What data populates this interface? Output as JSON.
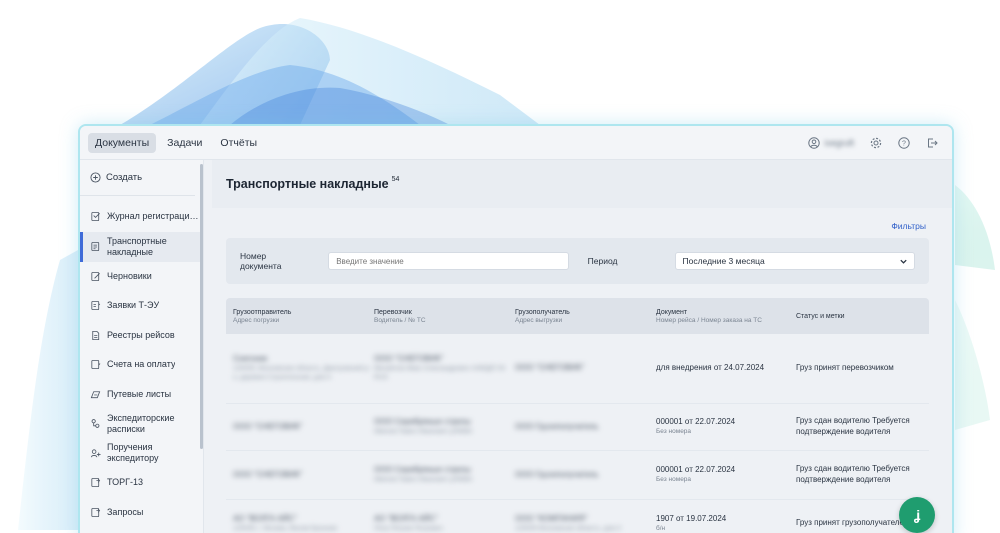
{
  "topbar": {
    "tabs": [
      {
        "label": "Документы",
        "active": true
      },
      {
        "label": "Задачи",
        "active": false
      },
      {
        "label": "Отчёты",
        "active": false
      }
    ],
    "user_name": "ivegruft"
  },
  "sidebar": {
    "create_label": "Создать",
    "items": [
      {
        "label": "Журнал регистрации ...",
        "icon": "journal-icon",
        "active": false
      },
      {
        "label": "Транспортные накладные",
        "icon": "document-icon",
        "active": true
      },
      {
        "label": "Черновики",
        "icon": "draft-icon",
        "active": false
      },
      {
        "label": "Заявки Т-ЭУ",
        "icon": "request-icon",
        "active": false
      },
      {
        "label": "Реестры рейсов",
        "icon": "registry-icon",
        "active": false
      },
      {
        "label": "Счета на оплату",
        "icon": "invoice-icon",
        "active": false
      },
      {
        "label": "Путевые листы",
        "icon": "waybill-icon",
        "active": false
      },
      {
        "label": "Экспедиторские расписки",
        "icon": "receipt-icon",
        "active": false
      },
      {
        "label": "Поручения экспедитору",
        "icon": "assignment-icon",
        "active": false
      },
      {
        "label": "ТОРГ-13",
        "icon": "torg-icon",
        "active": false
      },
      {
        "label": "Запросы",
        "icon": "query-icon",
        "active": false
      }
    ]
  },
  "page": {
    "title": "Транспортные накладные",
    "count": "54",
    "filters_link": "Фильтры"
  },
  "filter": {
    "doc_number_label": "Номер документа",
    "doc_number_placeholder": "Введите значение",
    "period_label": "Период",
    "period_value": "Последние 3 месяца"
  },
  "table": {
    "headers": [
      {
        "title": "Грузоотправитель",
        "subtitle": "Адрес погрузки"
      },
      {
        "title": "Перевозчик",
        "subtitle": "Водитель / № ТС"
      },
      {
        "title": "Грузополучатель",
        "subtitle": "Адрес выгрузки"
      },
      {
        "title": "Документ",
        "subtitle": "Номер рейса / Номер заказа на ТС"
      },
      {
        "title": "Статус и метки",
        "subtitle": ""
      }
    ],
    "rows": [
      {
        "shipper": "Снегоник",
        "shipper_sub": "125009, Московская область, Дмитровский р-н, деревня Строительная, дом 4",
        "carrier": "ООО \"СНЕГОВИК\"",
        "carrier_sub": "Михайлов Иван Александрович А456ДП 54 RUS",
        "consignee": "ООО \"СНЕГОВИК\"",
        "doc": "для внедрения от 24.07.2024",
        "doc_sub": "",
        "status": "Груз принят перевозчиком"
      },
      {
        "shipper": "ООО \"СНЕГОВИК\"",
        "shipper_sub": "",
        "carrier": "ООО Серебряные стрелы",
        "carrier_sub": "Ивенов Павел Иванович у056ВА",
        "consignee": "ООО Грузополучатель",
        "doc": "000001 от 22.07.2024",
        "doc_sub": "Без номера",
        "status": "Груз сдан водителю Требуется подтверждение водителя"
      },
      {
        "shipper": "ООО \"СНЕГОВИК\"",
        "shipper_sub": "",
        "carrier": "ООО Серебряные стрелы",
        "carrier_sub": "Ивенов Павел Иванович у056ВА",
        "consignee": "ООО Грузополучатель",
        "doc": "000001 от 22.07.2024",
        "doc_sub": "Без номера",
        "status": "Груз сдан водителю Требуется подтверждение водителя"
      },
      {
        "shipper": "АО \"ВОЛГА АЙС\"",
        "shipper_sub": "125009, г. Москва, Малая Бронная",
        "carrier": "АО \"ВОЛГА АЙС\"",
        "carrier_sub": "Петр Петров Петрович",
        "consignee": "ООО \"КОМПАНИЯ\"",
        "consignee_sub": "125009 Московская область, дом 4",
        "doc": "1907 от 19.07.2024",
        "doc_sub": "б/н",
        "status": "Груз принят грузополучателем"
      }
    ]
  },
  "colors": {
    "accent": "#3f6bd8",
    "fab": "#1f9d6f",
    "border_glow": "#aee6ef"
  }
}
